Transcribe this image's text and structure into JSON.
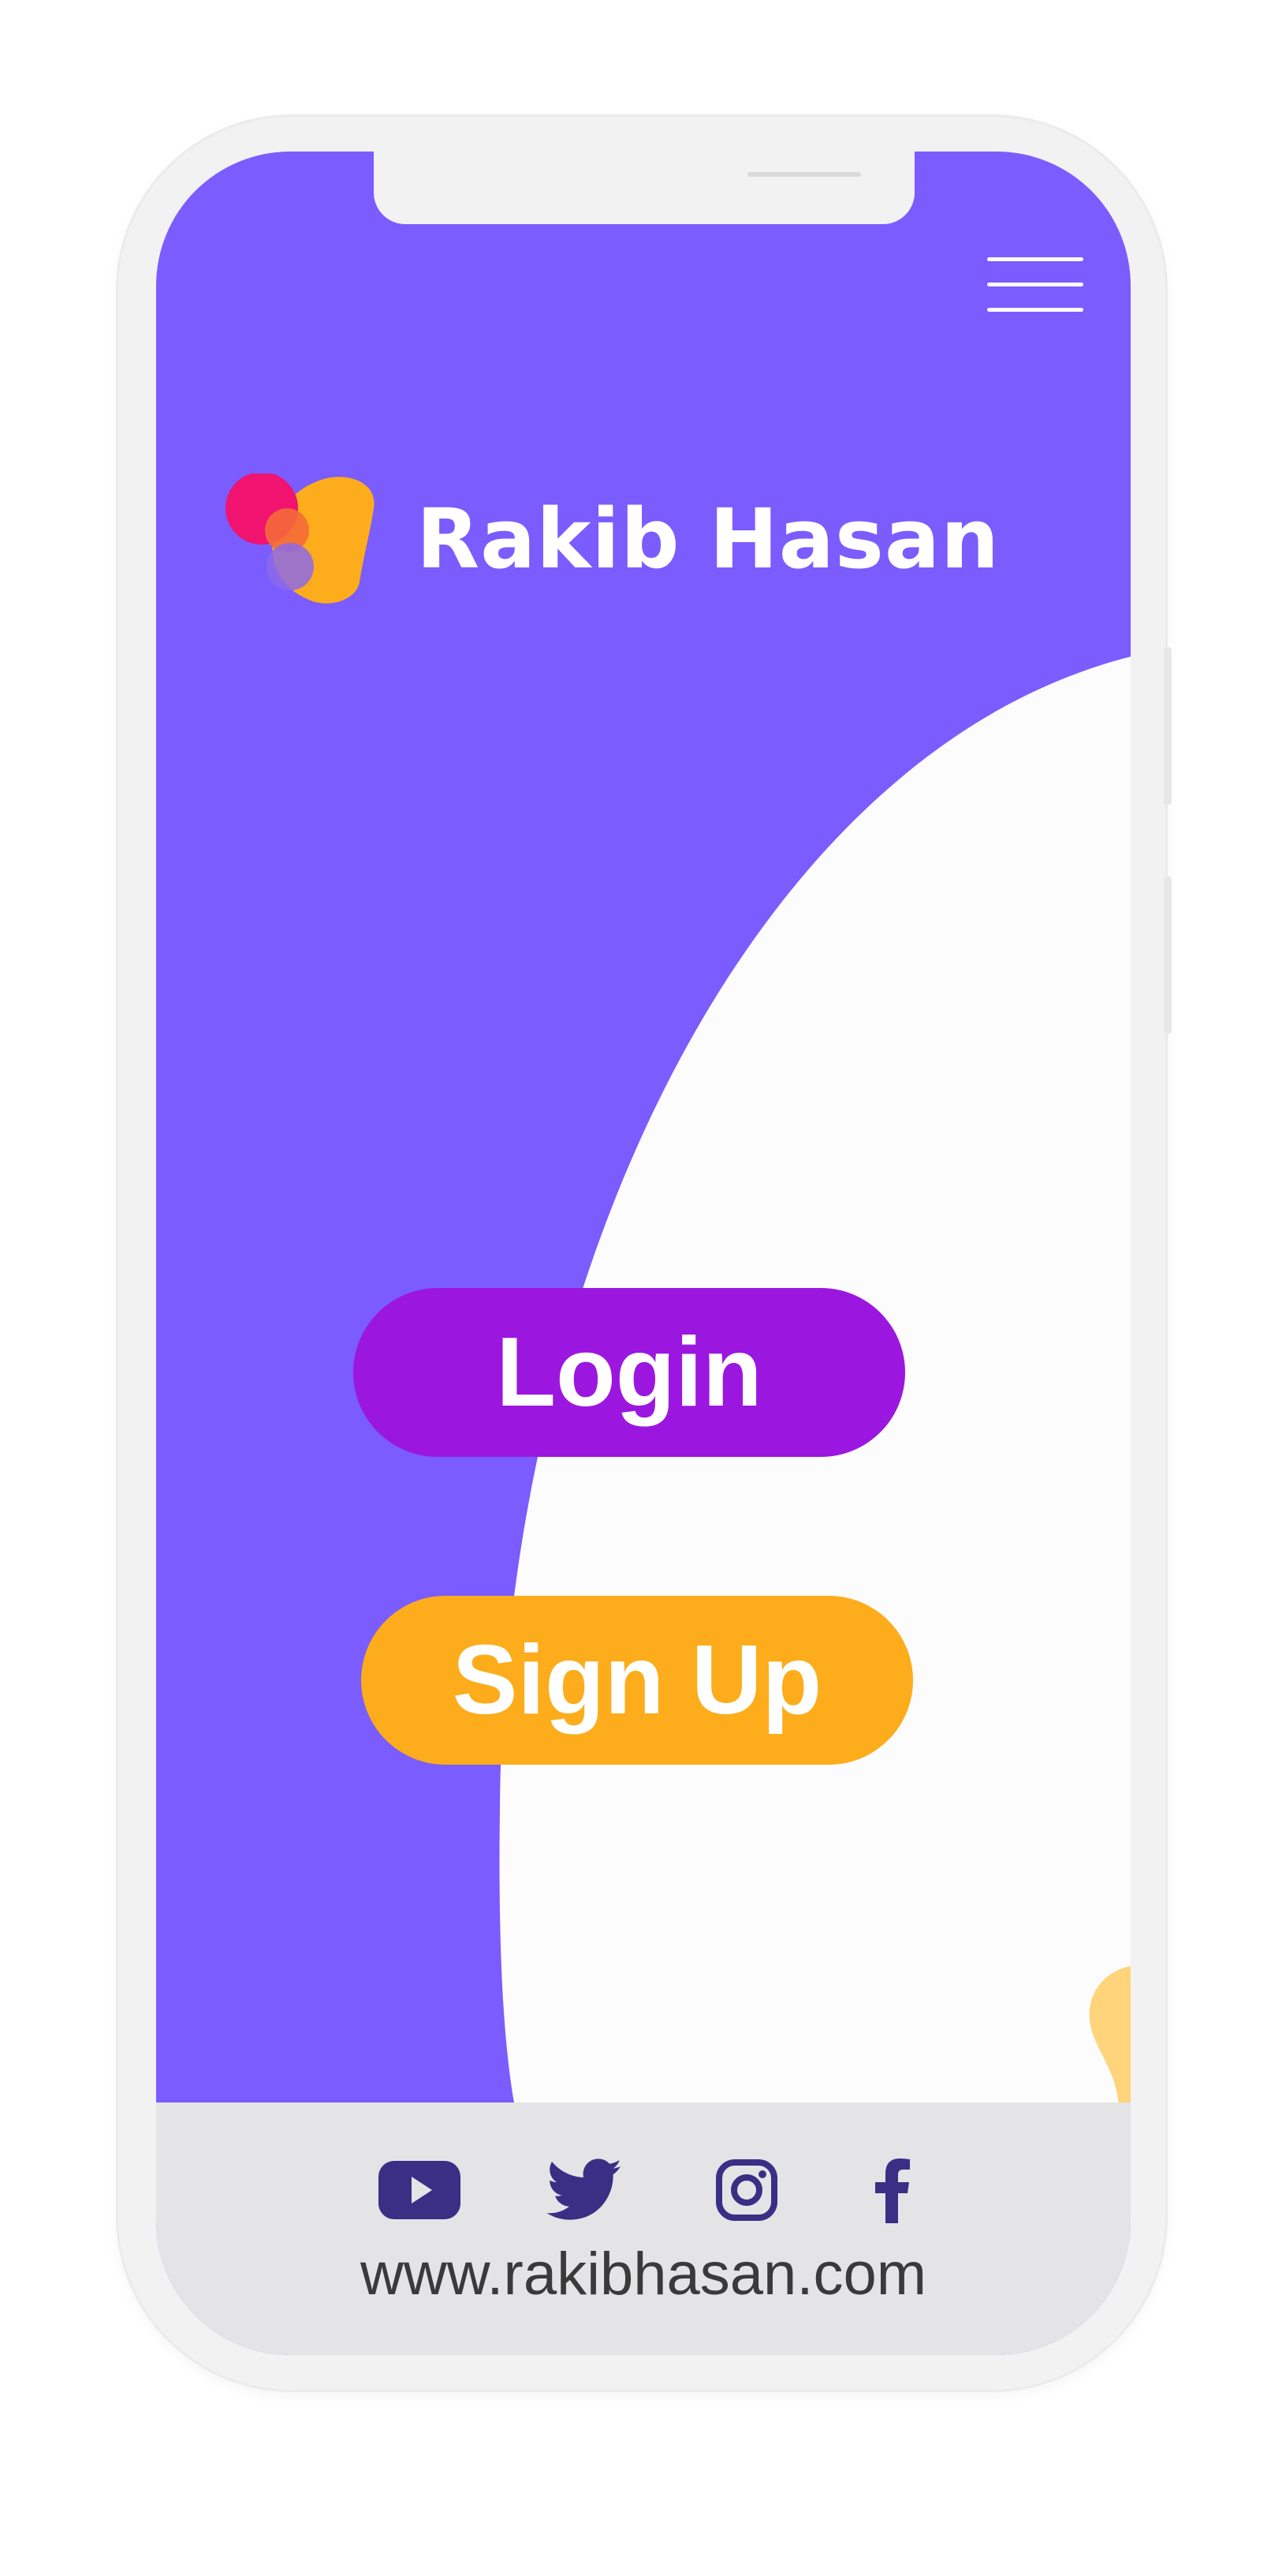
{
  "colors": {
    "primary": "#7a5cff",
    "login_button": "#9b17df",
    "signup_button": "#fdac1b",
    "footer_bg": "#e4e4e6",
    "social_icons": "#3a2f85",
    "logo_pink": "#f0136f",
    "logo_orange": "#fdac1b"
  },
  "header": {
    "menu_icon": "hamburger-menu-icon"
  },
  "brand": {
    "name": "Rakib Hasan",
    "logo_icon": "blob-logo-icon"
  },
  "actions": {
    "login_label": "Login",
    "signup_label": "Sign Up"
  },
  "footer": {
    "social_icons": [
      "youtube-icon",
      "twitter-icon",
      "instagram-icon",
      "facebook-icon"
    ],
    "website": "www.rakibhasan.com"
  }
}
